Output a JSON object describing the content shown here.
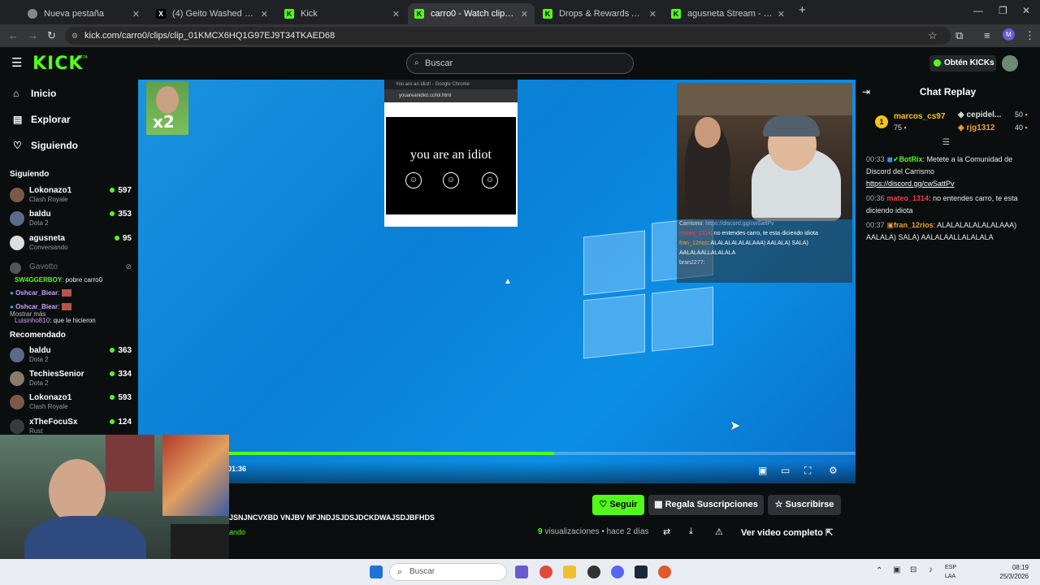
{
  "browser": {
    "tabs": [
      {
        "label": "Nueva pestaña",
        "active": false
      },
      {
        "label": "(4) Geito Washed en X: \"Twitter\"",
        "active": false
      },
      {
        "label": "Kick",
        "active": false
      },
      {
        "label": "carro0 - Watch clips on Kick",
        "active": true
      },
      {
        "label": "Drops & Rewards All Campaigns",
        "active": false
      },
      {
        "label": "agusneta Stream - Watch Live on",
        "active": false
      }
    ],
    "url": "kick.com/carro0/clips/clip_01KMCX6HQ1G97EJ9T34TKAED68"
  },
  "kick": {
    "logo": "KICK",
    "logo_beta": "BETA",
    "search_placeholder": "Buscar",
    "obtain_label": "Obtén KICKs"
  },
  "sidebar": {
    "nav": [
      {
        "label": "Inicio",
        "icon": "home-icon"
      },
      {
        "label": "Explorar",
        "icon": "compass-icon"
      },
      {
        "label": "Siguiendo",
        "icon": "heart-icon"
      }
    ],
    "following_title": "Siguiendo",
    "following": [
      {
        "name": "Lokonazo1",
        "category": "Clash Royale",
        "viewers": "597"
      },
      {
        "name": "baldu",
        "category": "Dota 2",
        "viewers": "353"
      },
      {
        "name": "agusneta",
        "category": "Conversando",
        "viewers": "95"
      }
    ],
    "offline": {
      "name": "Gavotto"
    },
    "following_msgs": [
      {
        "user": "SW4GGERBOY",
        "text": ": pobre carro0"
      },
      {
        "user": "Oshcar_Biear",
        "text": ":"
      },
      {
        "user": "Oshcar_Biear",
        "text": ":"
      },
      {
        "user": "Luisinho810",
        "text": ": que le hicieron"
      }
    ],
    "show_more": "Mostrar más",
    "recommended_title": "Recomendado",
    "recommended": [
      {
        "name": "baldu",
        "category": "Dota 2",
        "viewers": "363"
      },
      {
        "name": "TechiesSenior",
        "category": "Dota 2",
        "viewers": "334"
      },
      {
        "name": "Lokonazo1",
        "category": "Clash Royale",
        "viewers": "593"
      },
      {
        "name": "xTheFocuSx",
        "category": "Rust",
        "viewers": "124"
      }
    ]
  },
  "video": {
    "x2_text": "x2",
    "idiot_window_title": "You are an idiot! - Google Chrome",
    "idiot_url": "youareanidiot.cc/lol.html",
    "idiot_text": "you are an idiot",
    "smiley": "☺",
    "cam_chat": [
      {
        "user": "Carrismo",
        "text": ": https://discord.gg/cwSattPv"
      },
      {
        "user": "mateo_1314",
        "text": ": no entendes carro, te esta diciendo idiota"
      },
      {
        "user": "fran_12rios",
        "text": ": ALALALALALALAAA) AALALA) SALA) AALALAALLALALALA"
      },
      {
        "user": "bran2277",
        "text": ":"
      }
    ],
    "timecode": "01:36",
    "progress": 0.52
  },
  "below": {
    "title": "JSNJNCVXBD VNJBV NFJNDJSJDSJDCKDWAJSDJBFHDS",
    "status": "ando",
    "follow": "Seguir",
    "gift": "Regala Suscripciones",
    "subscribe": "Suscribirse",
    "views_count": "9",
    "views_label": "visualizaciones",
    "age": "• hace 2 días",
    "full_video": "Ver video completo"
  },
  "chat": {
    "title": "Chat Replay",
    "top": [
      {
        "rank": "1",
        "name": "marcos_cs97",
        "amount": "75"
      },
      {
        "name": "cepidel...",
        "amount": "50"
      },
      {
        "name": "rjg1312",
        "amount": "40"
      }
    ],
    "messages": [
      {
        "time": "00:33",
        "user": "BotRix",
        "text": ": Metete a la Comunidad de Discord del Carrismo",
        "link": "https://discord.gg/cwSattPv"
      },
      {
        "time": "00:36",
        "user": "mateo_1314",
        "text": ": no entendes carro, te esta diciendo idiota"
      },
      {
        "time": "00:37",
        "user": "fran_12rios",
        "text": ": ALALALALALALALAAA) AALALA) SALA) AALALAALLALALALA"
      }
    ]
  },
  "taskbar": {
    "search": "Buscar",
    "lang1": "ESP",
    "lang2": "LAA",
    "time": "08:19",
    "date": "25/3/2026"
  },
  "colors": {
    "kick_green": "#53fc18",
    "desktop_blue": "#0a85dc"
  }
}
